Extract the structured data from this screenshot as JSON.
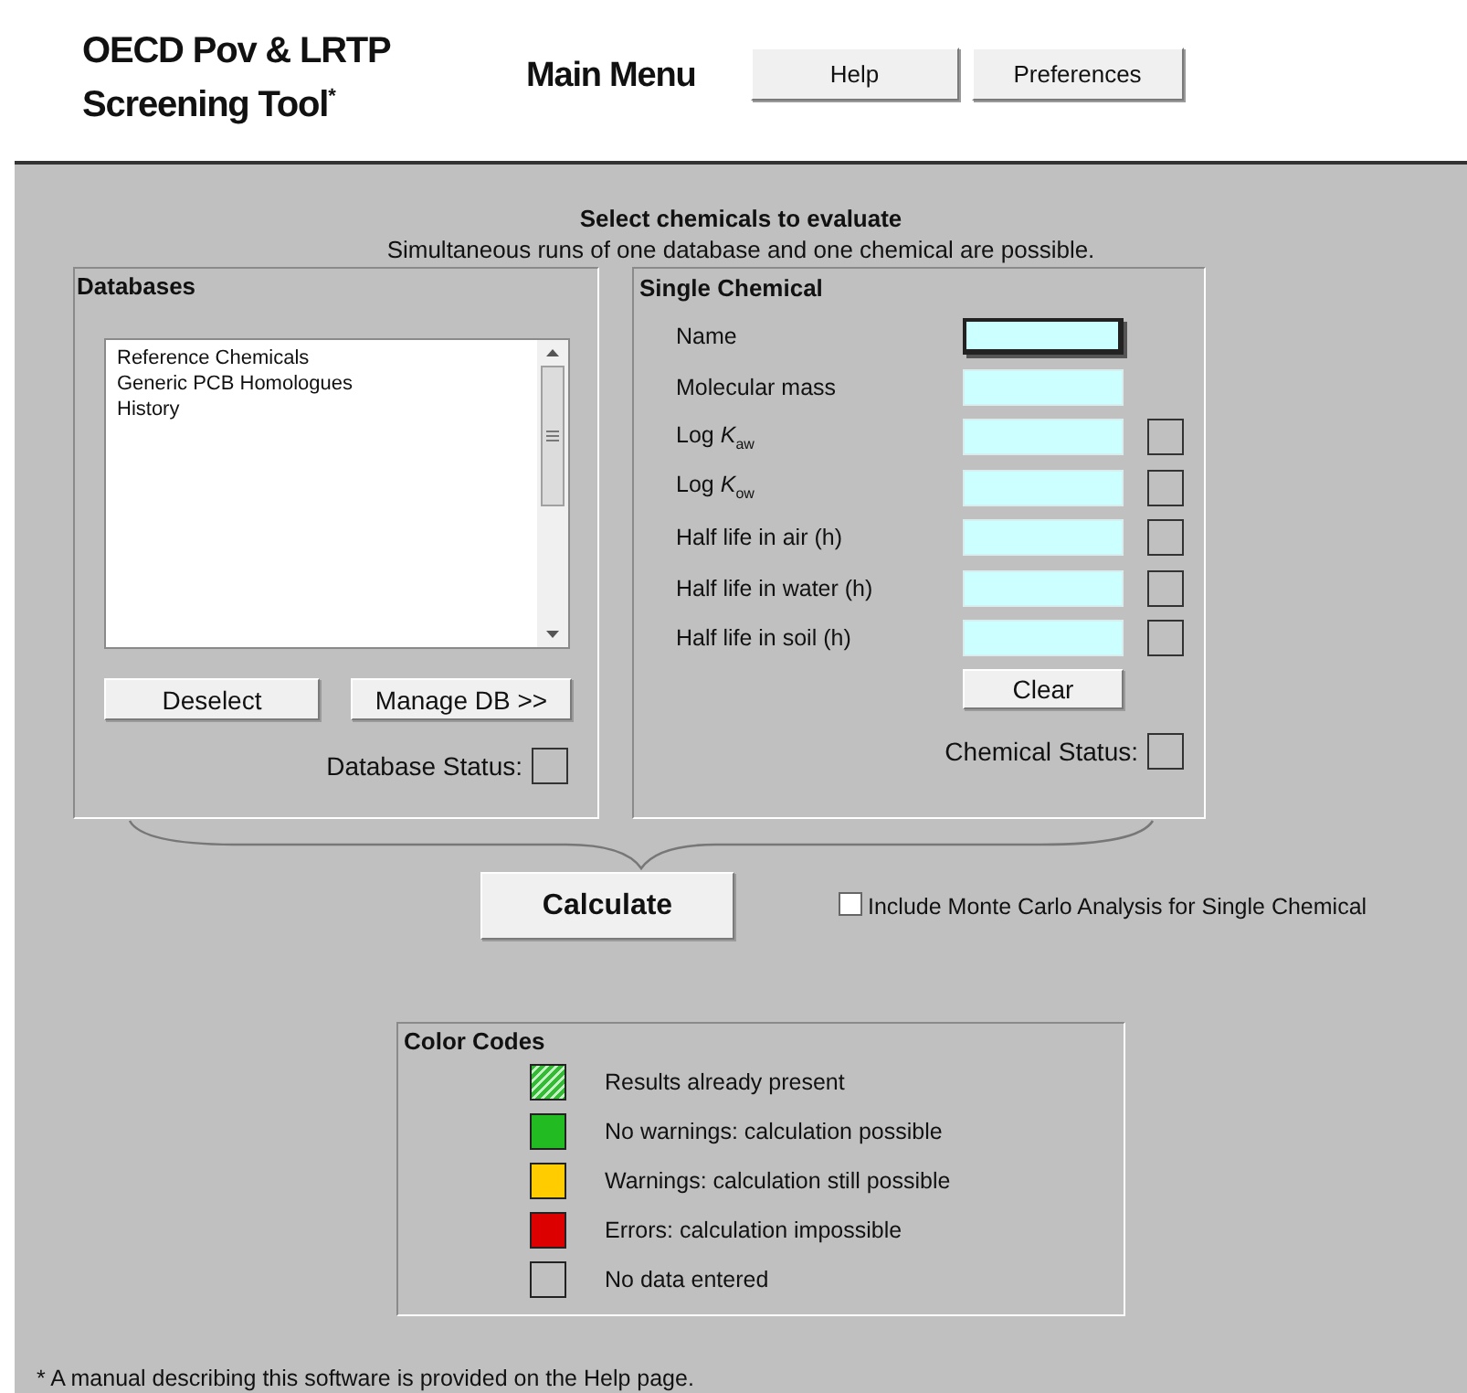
{
  "header": {
    "title_lines": [
      "OECD Pov & LRTP",
      "Screening Tool$^{*}$"
    ],
    "menu_label": "Main Menu",
    "buttons": [
      "Help",
      "Preferences"
    ]
  },
  "intro": {
    "heading": "Select chemicals to evaluate",
    "note": "Simultaneous runs of one database and one chemical are possible."
  },
  "databases": {
    "title": "Databases",
    "items": [
      {
        "label": "Reference Chemicals",
        "selected": false
      },
      {
        "label": "Generic PCB Homologues",
        "selected": false
      },
      {
        "label": "History",
        "selected": false
      }
    ],
    "buttons": [
      "Deselect",
      "Manage DB >>"
    ],
    "status_label": "Database Status:"
  },
  "single_chemical": {
    "title": "Single Chemical",
    "fields": [
      {
        "label": "Name",
        "focused": true,
        "has_status": false
      },
      {
        "label": "Molecular mass",
        "focused": false,
        "has_status": false
      },
      {
        "label": "Log *K*$_{aw}$",
        "focused": false,
        "has_status": true
      },
      {
        "label": "Log *K*$_{ow}$",
        "focused": false,
        "has_status": true
      },
      {
        "label": "Half life in air (h)",
        "focused": false,
        "has_status": true
      },
      {
        "label": "Half life in water (h)",
        "focused": false,
        "has_status": true
      },
      {
        "label": "Half life in soil (h)",
        "focused": false,
        "has_status": true
      }
    ],
    "clear_button": "Clear",
    "status_label": "Chemical Status:"
  },
  "calculate_button": "Calculate",
  "monte_carlo": {
    "label": "Include Monte Carlo Analysis for Single Chemical",
    "checked": false
  },
  "color_codes": {
    "title": "Color Codes",
    "items": [
      {
        "label": "Results already present",
        "kind": "hatched",
        "color": "#33bb33"
      },
      {
        "label": "No warnings: calculation possible",
        "kind": "solid",
        "color": "#22bb22"
      },
      {
        "label": "Warnings: calculation still possible",
        "kind": "solid",
        "color": "#ffcc00"
      },
      {
        "label": "Errors: calculation impossible",
        "kind": "solid",
        "color": "#dd0000"
      },
      {
        "label": "No data entered",
        "kind": "solid",
        "color": "#c0c0c0"
      }
    ]
  },
  "footnote": "* A manual describing this software is provided on the Help page."
}
